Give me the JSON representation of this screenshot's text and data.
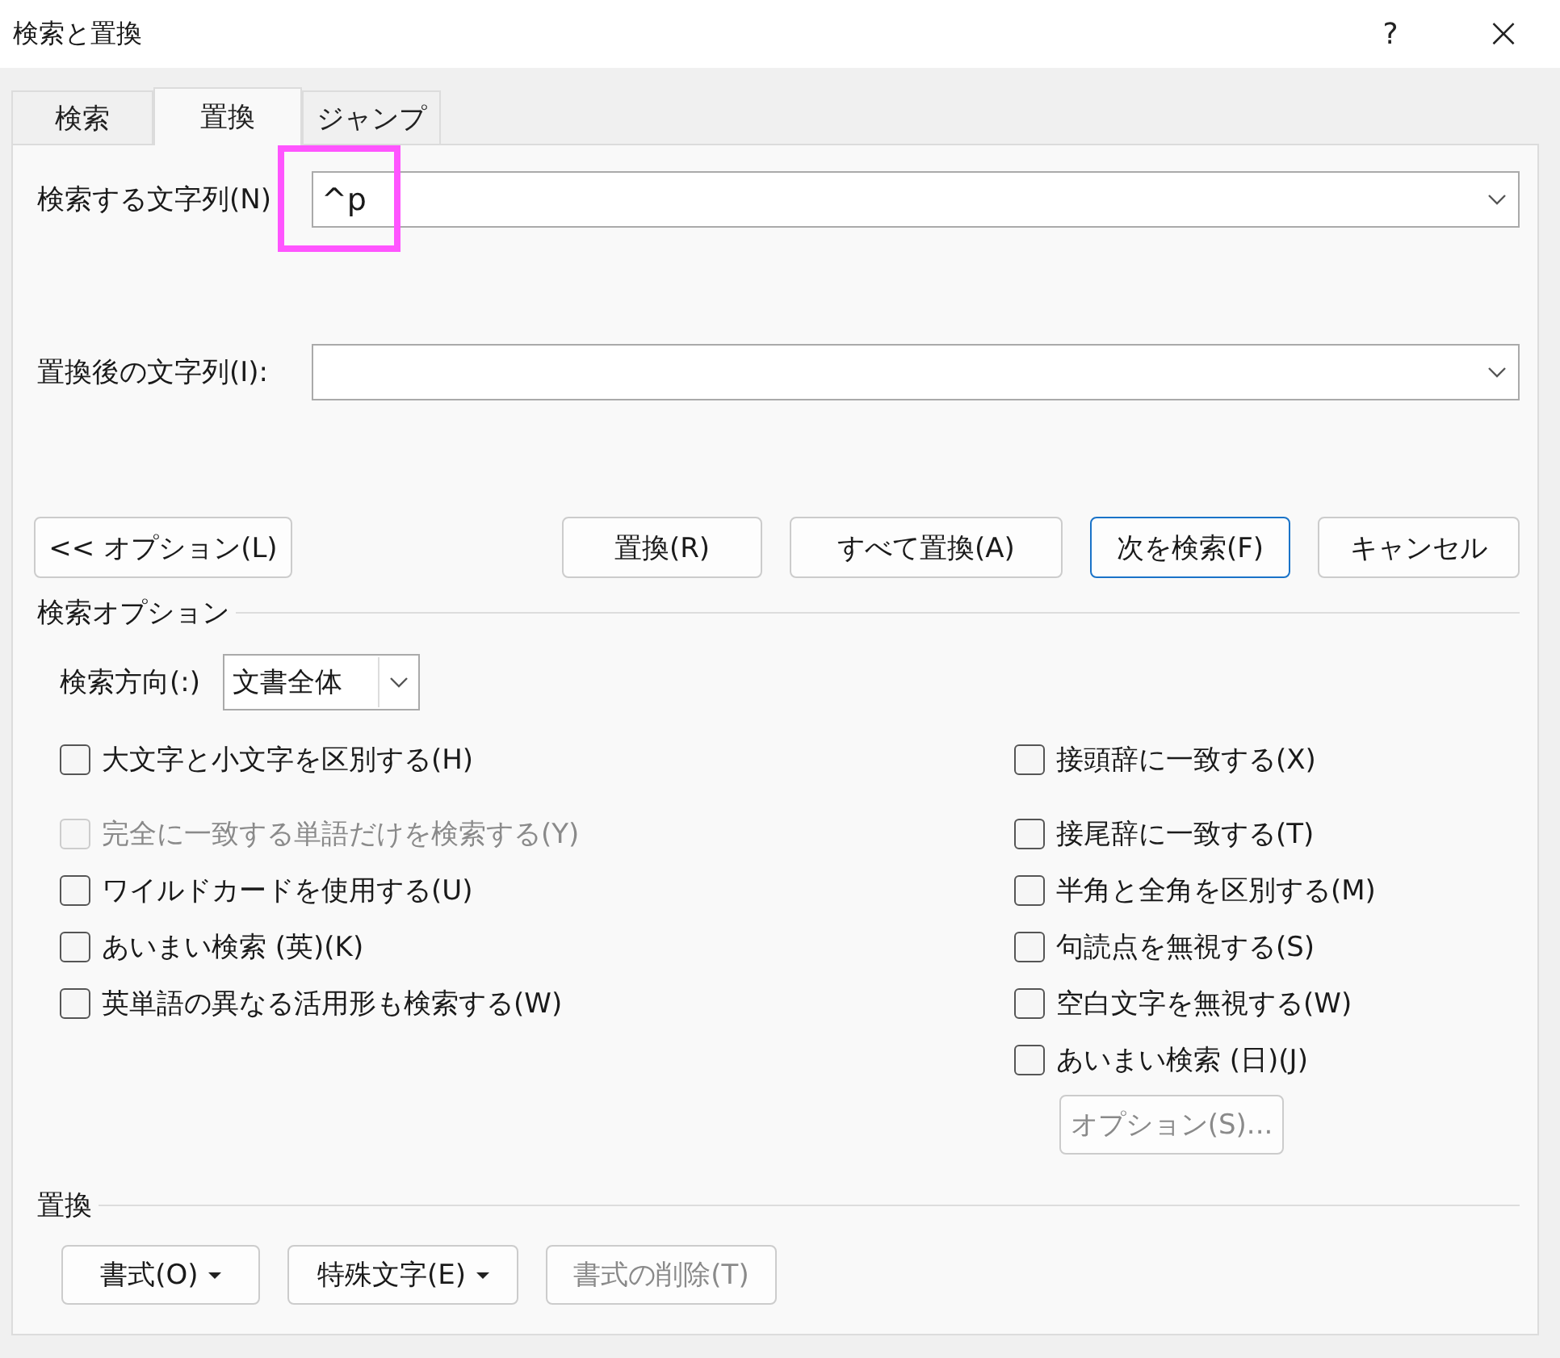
{
  "window": {
    "title": "検索と置換",
    "help": "?",
    "close": "×"
  },
  "tabs": [
    {
      "label": "検索",
      "selected": false
    },
    {
      "label": "置換",
      "selected": true
    },
    {
      "label": "ジャンプ",
      "selected": false
    }
  ],
  "find": {
    "label": "検索する文字列(N)",
    "value": "^p",
    "highlighted": true
  },
  "replace": {
    "label": "置換後の文字列(I):"
  },
  "buttons": [
    {
      "label": "<< オプション(L)",
      "default": false
    },
    {
      "label": "置換(R)",
      "default": false
    },
    {
      "label": "すべて置換(A)",
      "default": false
    },
    {
      "label": "次を検索(F)",
      "default": true
    },
    {
      "label": "キャンセル",
      "default": false
    }
  ],
  "search_options": {
    "heading": "検索オプション",
    "direction": {
      "label": "検索方向(:)",
      "value": "文書全体"
    },
    "left": [
      {
        "label": "大文字と小文字を区別する(H)",
        "checked": false,
        "disabled": false
      },
      {
        "label": "完全に一致する単語だけを検索する(Y)",
        "checked": false,
        "disabled": true
      },
      {
        "label": "ワイルドカードを使用する(U)",
        "checked": false,
        "disabled": false
      },
      {
        "label": "あいまい検索 (英)(K)",
        "checked": false,
        "disabled": false
      },
      {
        "label": "英単語の異なる活用形も検索する(W)",
        "checked": false,
        "disabled": false
      }
    ],
    "right": [
      {
        "label": "接頭辞に一致する(X)",
        "checked": false,
        "disabled": false
      },
      {
        "label": "接尾辞に一致する(T)",
        "checked": false,
        "disabled": false
      },
      {
        "label": "半角と全角を区別する(M)",
        "checked": false,
        "disabled": false
      },
      {
        "label": "句読点を無視する(S)",
        "checked": false,
        "disabled": false
      },
      {
        "label": "空白文字を無視する(W)",
        "checked": false,
        "disabled": false
      },
      {
        "label": "あいまい検索 (日)(J)",
        "checked": false,
        "disabled": false
      }
    ],
    "options_button": {
      "label": "オプション(S)...",
      "disabled": true
    }
  },
  "replace_section": {
    "heading": "置換",
    "buttons": [
      {
        "label": "書式(O)",
        "menu": true,
        "disabled": false
      },
      {
        "label": "特殊文字(E)",
        "menu": true,
        "disabled": false
      },
      {
        "label": "書式の削除(T)",
        "menu": false,
        "disabled": true
      }
    ]
  }
}
